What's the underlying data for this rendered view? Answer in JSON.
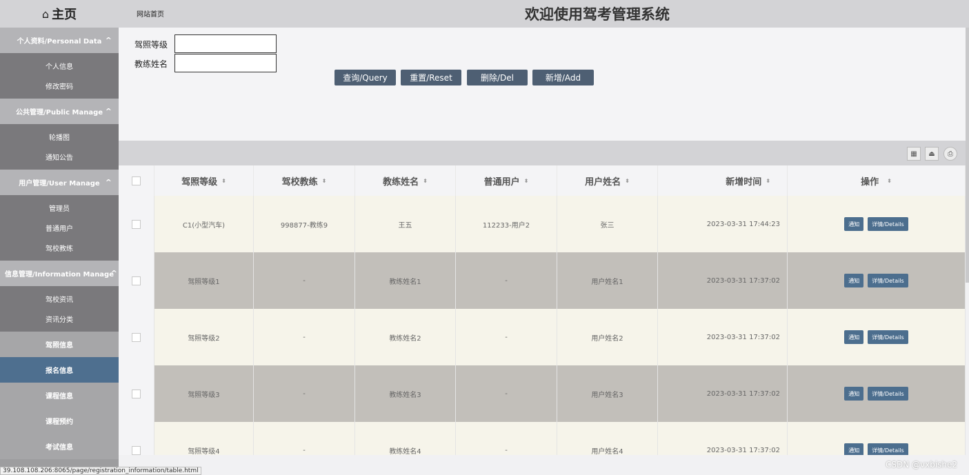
{
  "sidebar": {
    "home_label": "主页",
    "home_icon": "home-icon",
    "groups": [
      {
        "title": "个人资料/Personal Data",
        "items": [
          "个人信息",
          "修改密码"
        ]
      },
      {
        "title": "公共管理/Public Manage",
        "items": [
          "轮播图",
          "通知公告"
        ]
      },
      {
        "title": "用户管理/User Manage",
        "items": [
          "管理员",
          "普通用户",
          "驾校教练"
        ]
      },
      {
        "title": "信息管理/Information Manage",
        "items": [
          "驾校资讯",
          "资讯分类"
        ]
      }
    ],
    "menu": [
      "驾照信息",
      "报名信息",
      "课程信息",
      "课程预约",
      "考试信息"
    ],
    "active_menu": "报名信息",
    "chevron": "^"
  },
  "topbar": {
    "breadcrumb": "网站首页",
    "title": "欢迎使用驾考管理系统"
  },
  "search": {
    "license_level_label": "驾照等级",
    "coach_name_label": "教练姓名",
    "license_level_value": "",
    "coach_name_value": "",
    "buttons": {
      "query": "查询/Query",
      "reset": "重置/Reset",
      "delete": "删除/Del",
      "add": "新增/Add"
    }
  },
  "table": {
    "headers": [
      "驾照等级",
      "驾校教练",
      "教练姓名",
      "普通用户",
      "用户姓名",
      "新增时间",
      "操作"
    ],
    "sort_icon": "⬍",
    "rows": [
      {
        "level": "C1(小型汽车)",
        "coach": "998877-教练9",
        "coach_name": "王五",
        "user": "112233-用户2",
        "user_name": "张三",
        "time": "2023-03-31 17:44:23"
      },
      {
        "level": "驾照等级1",
        "coach": "-",
        "coach_name": "教练姓名1",
        "user": "-",
        "user_name": "用户姓名1",
        "time": "2023-03-31 17:37:02"
      },
      {
        "level": "驾照等级2",
        "coach": "-",
        "coach_name": "教练姓名2",
        "user": "-",
        "user_name": "用户姓名2",
        "time": "2023-03-31 17:37:02"
      },
      {
        "level": "驾照等级3",
        "coach": "-",
        "coach_name": "教练姓名3",
        "user": "-",
        "user_name": "用户姓名3",
        "time": "2023-03-31 17:37:02"
      },
      {
        "level": "驾照等级4",
        "coach": "-",
        "coach_name": "教练姓名4",
        "user": "-",
        "user_name": "用户姓名4",
        "time": "2023-03-31 17:37:02"
      }
    ],
    "action_notify": "通知",
    "action_details": "详情/Details",
    "toolbar_icons": [
      "columns-icon",
      "export-icon",
      "print-icon"
    ]
  },
  "statusbar": {
    "url": "39.108.108.206:8065/page/registration_information/table.html"
  },
  "watermark": "CSDN @vxbishe2",
  "colors": {
    "active_menu": "#4e6f8f",
    "button": "#4e5f73",
    "action_button": "#4c6e8e",
    "row_light": "#f6f4ea",
    "row_dark": "#c2bfba"
  }
}
